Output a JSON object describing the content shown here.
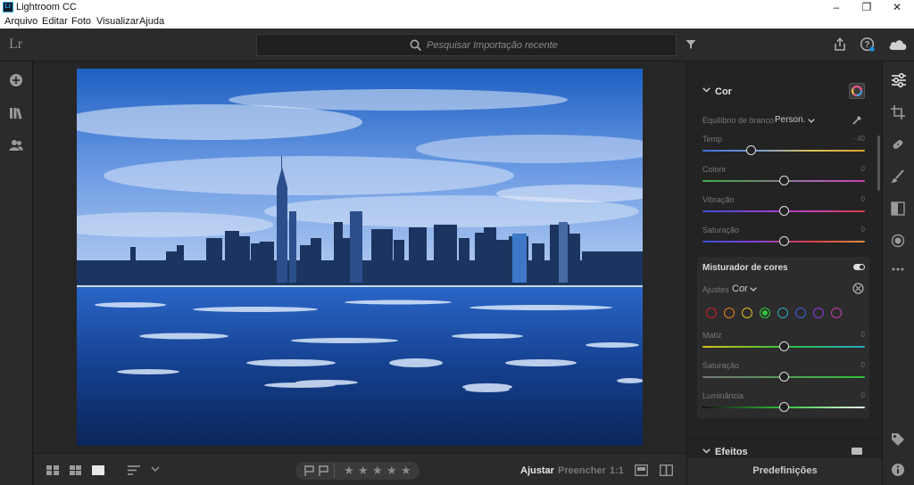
{
  "window": {
    "title": "Lightroom CC",
    "app_icon": "Lr",
    "minimize": "–",
    "maximize": "❐",
    "close": "✕"
  },
  "menu": [
    "Arquivo",
    "Editar",
    "Foto",
    "Visualizar",
    "Ajuda"
  ],
  "topbar": {
    "logo": "Lr",
    "search_placeholder": "Pesquisar Importação recente"
  },
  "panel": {
    "section_title": "Cor",
    "white_balance": {
      "label": "Equilíbrio de branco",
      "value": "Person."
    },
    "sliders": [
      {
        "label": "Temp",
        "value": "- 40",
        "position": 0.3
      },
      {
        "label": "Colorir",
        "value": "0",
        "position": 0.5
      },
      {
        "label": "Vibração",
        "value": "0",
        "position": 0.5
      },
      {
        "label": "Saturação",
        "value": "0",
        "position": 0.5
      }
    ],
    "mixer": {
      "title": "Misturador de cores",
      "adjust_label": "Ajustes",
      "adjust_value": "Cor",
      "swatches": [
        {
          "color": "#d21f2a",
          "selected": false
        },
        {
          "color": "#e2851c",
          "selected": false
        },
        {
          "color": "#d9c21c",
          "selected": false
        },
        {
          "color": "#30c23a",
          "selected": true
        },
        {
          "color": "#2aa7c7",
          "selected": false
        },
        {
          "color": "#3b5fe0",
          "selected": false
        },
        {
          "color": "#8a3fd9",
          "selected": false
        },
        {
          "color": "#c83fb4",
          "selected": false
        }
      ],
      "sliders": [
        {
          "label": "Matiz",
          "value": "0",
          "position": 0.5
        },
        {
          "label": "Saturação",
          "value": "0",
          "position": 0.5
        },
        {
          "label": "Luminância",
          "value": "0",
          "position": 0.5
        }
      ]
    },
    "effects_title": "Efeitos",
    "presets_button": "Predefinições"
  },
  "bottombar": {
    "tab_adjust": "Ajustar",
    "tab_fill": "Preencher",
    "tab_1to1": "1:1"
  },
  "colors": {
    "accent": "#1e8fd4",
    "panel_bg": "#232323",
    "toolbar_bg": "#2b2b2b"
  }
}
